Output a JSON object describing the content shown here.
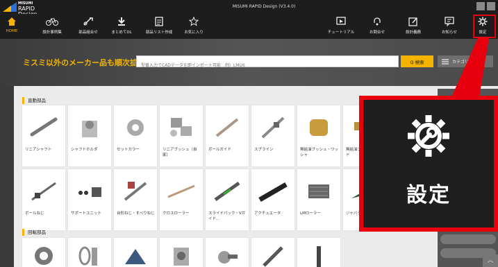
{
  "app": {
    "brand": "MISUMI",
    "product": "RAPID Design",
    "window_title": "MISUMI RAPID Design (V3.4.0)"
  },
  "toolbar": {
    "left": [
      {
        "label": "HOME",
        "icon": "home-icon"
      },
      {
        "label": "設計事例集",
        "icon": "bicycle-icon"
      },
      {
        "label": "部品組合せ",
        "icon": "parts-combination-icon"
      },
      {
        "label": "まとめてDL",
        "icon": "download-icon"
      },
      {
        "label": "部品リスト作成",
        "icon": "parts-list-icon"
      },
      {
        "label": "お気に入り",
        "icon": "star-icon"
      }
    ],
    "right": [
      {
        "label": "チュートリアル",
        "icon": "tutorial-icon"
      },
      {
        "label": "お問合せ",
        "icon": "inquiry-icon"
      },
      {
        "label": "設計義務",
        "icon": "edit-icon"
      },
      {
        "label": "お知らせ",
        "icon": "notice-icon"
      },
      {
        "label": "設定",
        "icon": "gear-icon"
      }
    ]
  },
  "search": {
    "slogan": "ミスミ以外のメーカー品も順次拡大中",
    "placeholder": "型番入力でCADデータを即インポート可能　例）LMU6",
    "button_label": "Q 検索",
    "category_label": "カテゴリ検索"
  },
  "sections": [
    {
      "title": "直動部品",
      "rows": [
        [
          "リニアシャフト",
          "シャフトホルダ",
          "セットカラー",
          "リニアブッシュ（自家）",
          "ボールガイド",
          "スプライン",
          "無給油ブッシュ・ワッシャ",
          "無給油プレート・ガイド"
        ],
        [
          "ボールねじ",
          "サポートユニット",
          "台形ねじ・すべりねじ",
          "クロスローラー",
          "スライドパック・Vガイド...",
          "アクチュエータ",
          "LMローラー",
          "ジャバラ"
        ]
      ]
    },
    {
      "title": "回転部品",
      "rows": [
        [
          "",
          "",
          "",
          "",
          "",
          "",
          ""
        ]
      ]
    }
  ],
  "callout": {
    "label": "設定",
    "icon": "gear-wrench-icon"
  },
  "colors": {
    "accent": "#f4b400",
    "highlight": "#e8000e",
    "toolbar": "#1d1d1d"
  }
}
